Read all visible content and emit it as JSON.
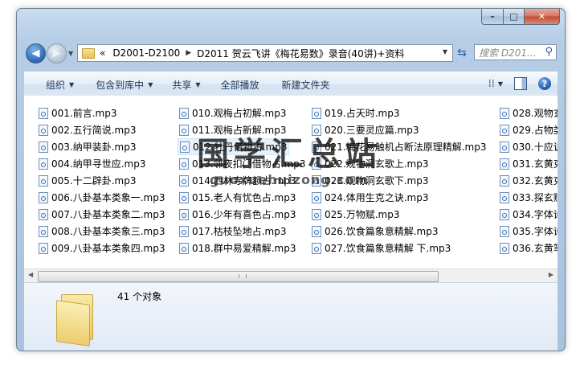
{
  "window": {
    "caption_buttons": [
      {
        "name": "minimize",
        "glyph": "–"
      },
      {
        "name": "maximize",
        "glyph": "□"
      },
      {
        "name": "close",
        "glyph": "✕"
      }
    ]
  },
  "nav": {
    "back_glyph": "◀",
    "forward_glyph": "▶",
    "breadcrumb_prefix": "«",
    "breadcrumbs": [
      "D2001-D2100",
      "D2011 贺云飞讲《梅花易数》录音(40讲)+资料"
    ],
    "separator": "▶",
    "search_placeholder": "搜索 D201...",
    "search_icon": "magnifier-icon",
    "refresh_icon": "refresh-icon"
  },
  "toolbar": {
    "organize": "组织",
    "include_in_library": "包含到库中",
    "share": "共享",
    "play_all": "全部播放",
    "new_folder": "新建文件夹"
  },
  "files": {
    "col1": [
      "001.前言.mp3",
      "002.五行简说.mp3",
      "003.纳甲装卦.mp3",
      "004.纳甲寻世应.mp3",
      "005.十二辟卦.mp3",
      "006.八卦基本类象一.mp3",
      "007.八卦基本类象二.mp3",
      "008.八卦基本类象三.mp3",
      "009.八卦基本类象四.mp3"
    ],
    "col2": [
      "010.观梅占初解.mp3",
      "011.观梅占新解.mp3",
      "012.牡丹借物占.mp3",
      "013.邻夜扣门借物占.mp3",
      "014.西林寺牌额占.mp3",
      "015.老人有忧色占.mp3",
      "016.少年有喜色占.mp3",
      "017.枯枝坠地占.mp3",
      "018.群中易爱精解.mp3"
    ],
    "col3": [
      "019.占天时.mp3",
      "020.三要灵应篇.mp3",
      "021.梅花易触机占断法原理精解.mp3",
      "022.观物洞玄歌上.mp3",
      "023.观物洞玄歌下.mp3",
      "024.体用生克之诀.mp3",
      "025.万物赋.mp3",
      "026.饮食篇象意精解.mp3",
      "027.饮食篇象意精解 下.mp3"
    ],
    "col4": [
      "028.观物玄",
      "029.占物类",
      "030.十应诀",
      "031.玄黄克",
      "032.玄黄克",
      "033.探玄赋",
      "034.字体诗",
      "035.字体诗",
      "036.玄黄笔"
    ]
  },
  "status": {
    "count_text": "41 个对象"
  },
  "watermark": {
    "title": "国学汇总站",
    "url": "guoxuehuizong.com"
  }
}
